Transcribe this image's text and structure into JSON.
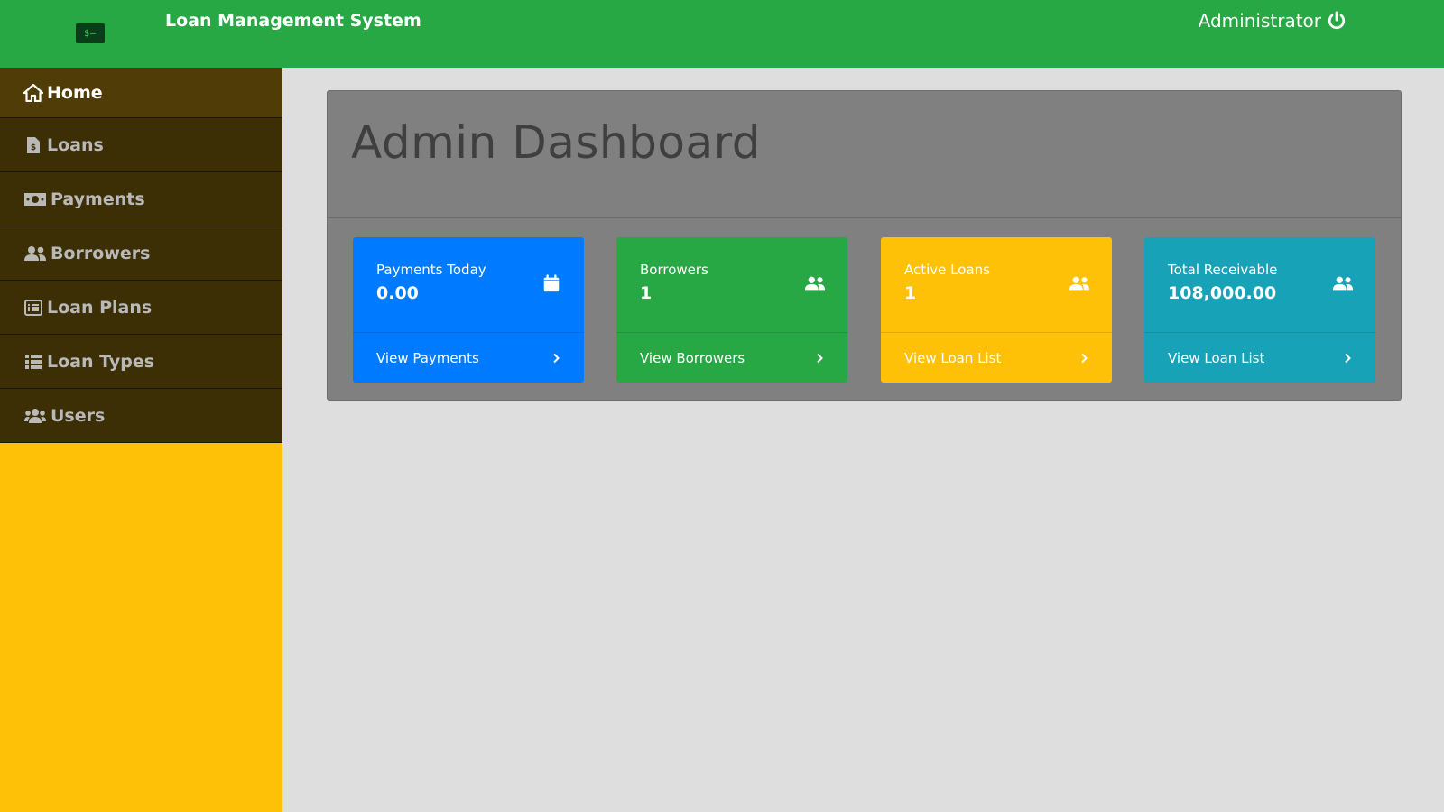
{
  "header": {
    "logo_text": "$",
    "title": "Loan Management System",
    "user": "Administrator"
  },
  "sidebar": {
    "items": [
      {
        "label": "Home",
        "icon": "home-icon",
        "active": true
      },
      {
        "label": "Loans",
        "icon": "file-invoice-dollar-icon"
      },
      {
        "label": "Payments",
        "icon": "money-bill-icon"
      },
      {
        "label": "Borrowers",
        "icon": "user-friends-icon"
      },
      {
        "label": "Loan Plans",
        "icon": "list-alt-icon"
      },
      {
        "label": "Loan Types",
        "icon": "th-list-icon"
      },
      {
        "label": "Users",
        "icon": "users-icon"
      }
    ]
  },
  "main": {
    "title": "Admin Dashboard",
    "cards": [
      {
        "label": "Payments Today",
        "value": "0.00",
        "link": "View Payments",
        "icon": "calendar-icon",
        "color": "#007bff"
      },
      {
        "label": "Borrowers",
        "value": "1",
        "link": "View Borrowers",
        "icon": "user-friends-icon",
        "color": "#28a745"
      },
      {
        "label": "Active Loans",
        "value": "1",
        "link": "View Loan List",
        "icon": "user-friends-icon",
        "color": "#ffc107"
      },
      {
        "label": "Total Receivable",
        "value": "108,000.00",
        "link": "View Loan List",
        "icon": "user-friends-icon",
        "color": "#17a2b8"
      }
    ]
  },
  "colors": {
    "header": "#28a745",
    "sidebar_bg": "#ffc107",
    "nav_item": "#3d2f05",
    "panel": "#808080",
    "page_bg": "#dedede"
  }
}
